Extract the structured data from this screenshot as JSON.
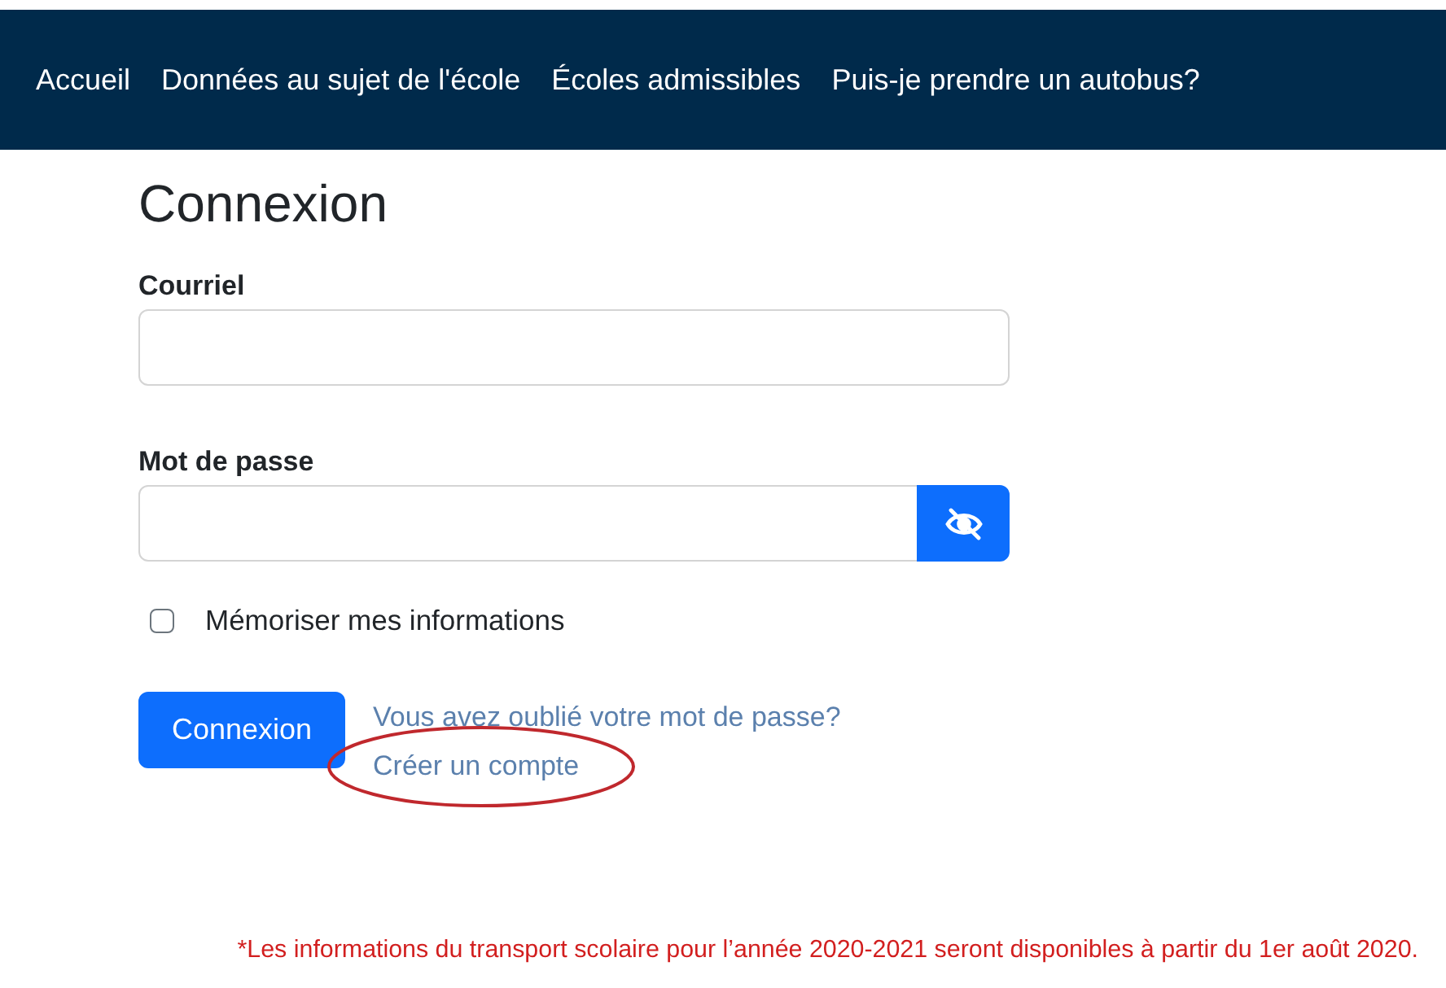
{
  "nav": {
    "items": [
      {
        "label": "Accueil"
      },
      {
        "label": "Données au sujet de l'école"
      },
      {
        "label": "Écoles admissibles"
      },
      {
        "label": "Puis-je prendre un autobus?"
      }
    ]
  },
  "login": {
    "title": "Connexion",
    "fields": [
      {
        "kind": "text",
        "label": "Courriel"
      },
      {
        "kind": "password",
        "label": "Mot de passe"
      }
    ],
    "remember": {
      "label": "Mémoriser mes informations",
      "checked": false
    },
    "submit": "Connexion",
    "links": [
      {
        "label": "Vous avez oublié votre mot de passe?",
        "circled": false
      },
      {
        "label": "Créer un compte",
        "circled": true
      }
    ]
  },
  "notice": "*Les informations du transport scolaire pour l’année 2020-2021 seront disponibles à partir du 1er août 2020."
}
